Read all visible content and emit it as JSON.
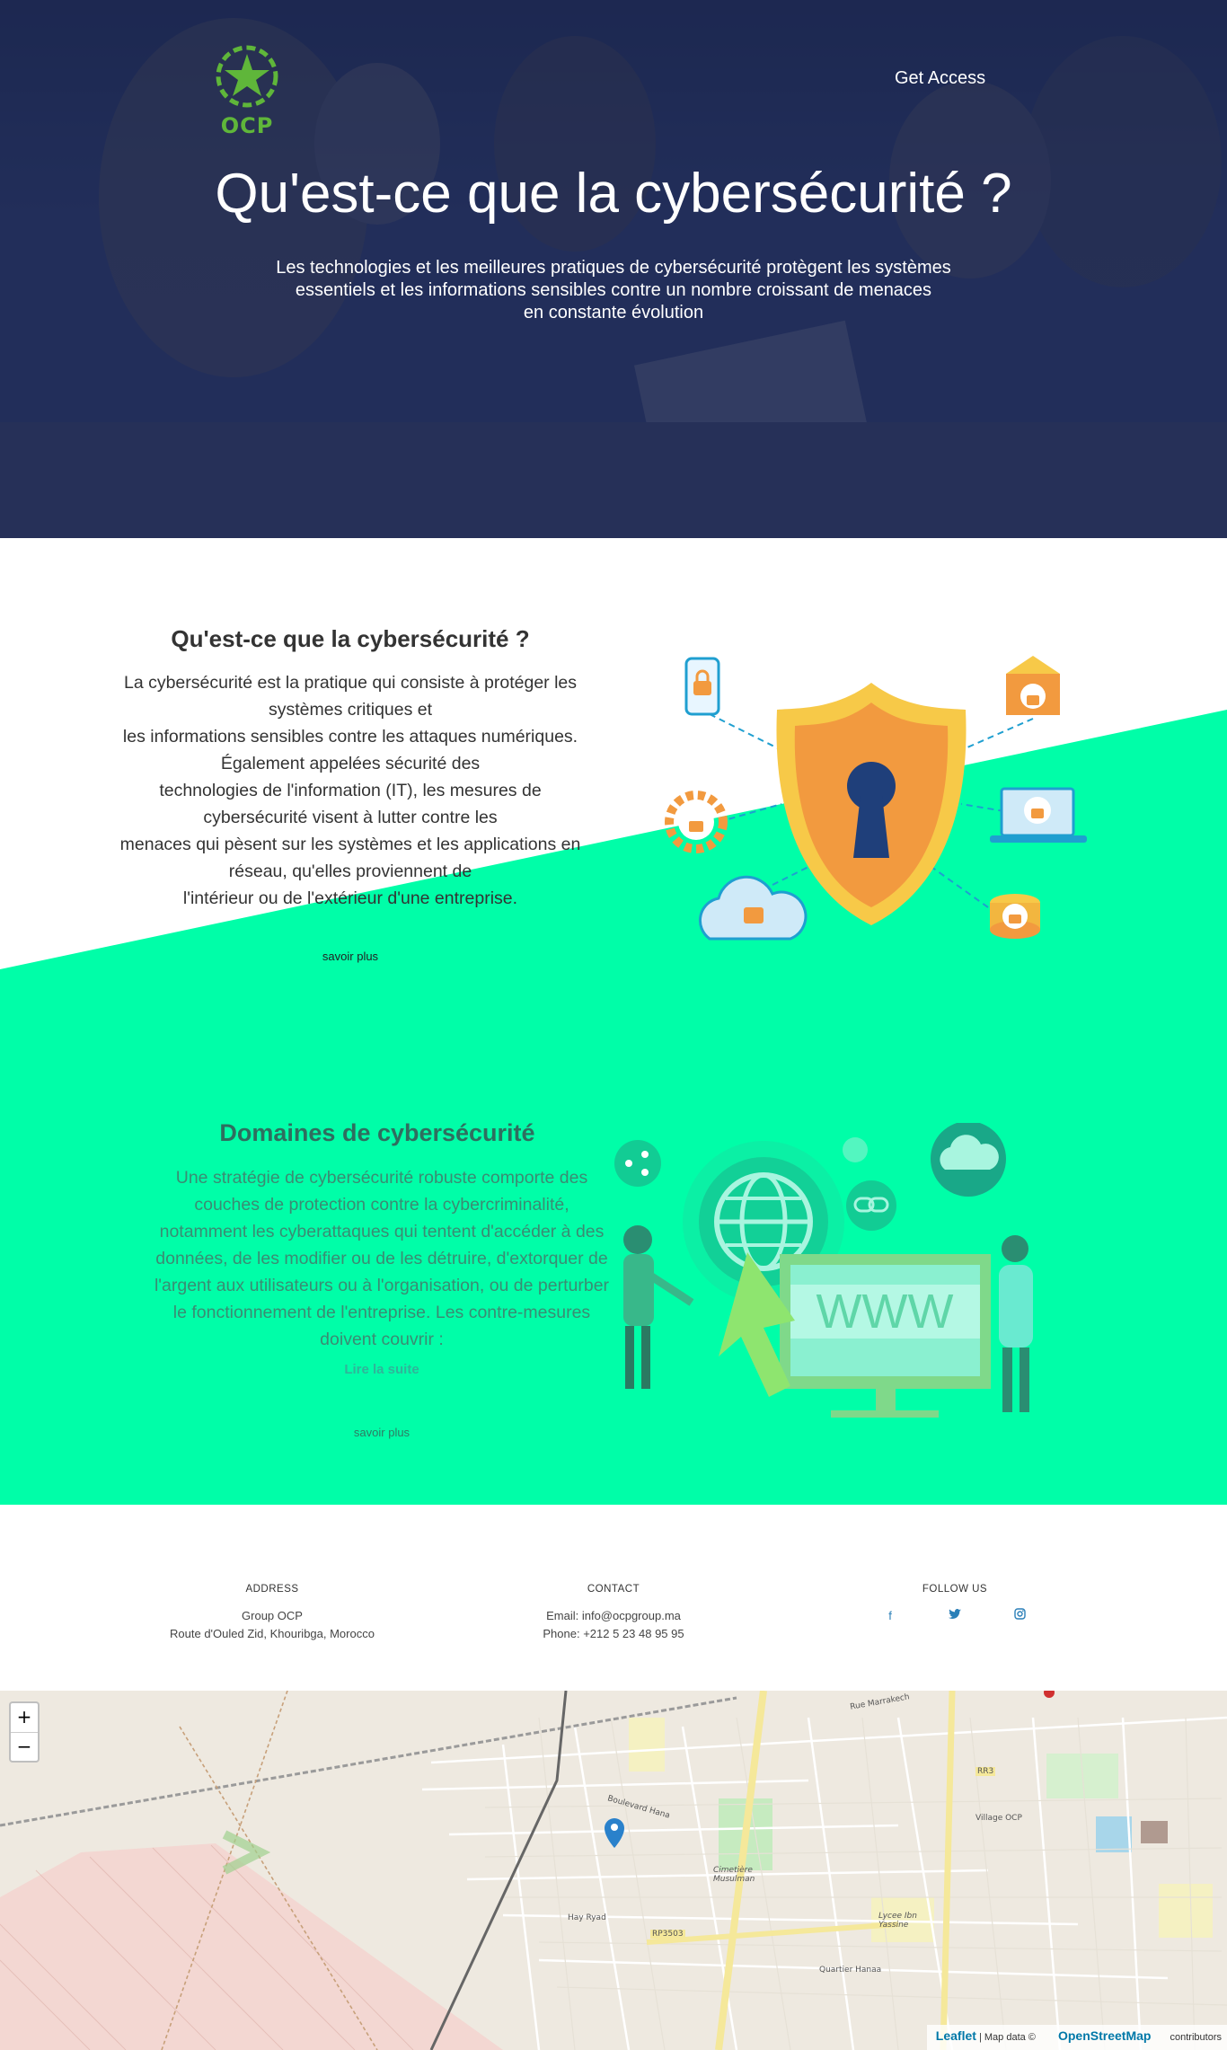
{
  "hero": {
    "logo_text": "OCP",
    "get_access": "Get Access",
    "title": "Qu'est-ce que la cybersécurité ?",
    "subtitle_lines": [
      "Les technologies et les meilleures pratiques de cybersécurité protègent les systèmes",
      "essentiels et les informations sensibles contre un nombre croissant de menaces",
      "en constante évolution"
    ]
  },
  "section1": {
    "title": "Qu'est-ce que la cybersécurité ?",
    "body_lines": [
      "La cybersécurité est la pratique qui consiste à protéger les",
      "systèmes critiques et",
      "les informations sensibles contre les attaques numériques.",
      "Également appelées sécurité des",
      "technologies de l'information (IT), les mesures de",
      "cybersécurité visent à lutter contre les",
      "menaces qui pèsent sur les systèmes et les applications en",
      "réseau, qu'elles proviennent de",
      "l'intérieur ou de l'extérieur d'une entreprise."
    ],
    "more": "savoir plus"
  },
  "section2": {
    "title": "Domaines de cybersécurité",
    "body_lines": [
      "Une stratégie de cybersécurité robuste comporte des",
      "couches de protection contre la cybercriminalité,",
      "notamment les cyberattaques qui tentent d'accéder à des",
      "données, de les modifier ou de les détruire, d'extorquer de",
      "l'argent aux utilisateurs ou à l'organisation, ou de perturber",
      "le fonctionnement de l'entreprise. Les contre-mesures",
      "doivent couvrir :"
    ],
    "read_more": "Lire la suite",
    "more": "savoir plus",
    "www_text": "WWW"
  },
  "footer": {
    "address": {
      "heading": "ADDRESS",
      "line1": "Group OCP",
      "line2": "Route d'Ouled Zid, Khouribga, Morocco"
    },
    "contact": {
      "heading": "CONTACT",
      "email": "Email: info@ocpgroup.ma",
      "phone": "Phone: +212 5 23 48 95 95"
    },
    "follow": {
      "heading": "FOLLOW US",
      "icons": [
        "facebook-icon",
        "twitter-icon",
        "instagram-icon"
      ]
    }
  },
  "map": {
    "zoom_in": "+",
    "zoom_out": "−",
    "leaflet": "Leaflet",
    "map_data": "| Map data ©",
    "osm": "OpenStreetMap",
    "contributors": "contributors",
    "labels": [
      "Boulevard Hana",
      "Hay Ryad",
      "RP3503",
      "Cimetière Musulman",
      "Village OCP",
      "RR3",
      "Lycee Ibn Yassine",
      "Quartier Hanaa",
      "Rue Marrakech"
    ]
  },
  "colors": {
    "hero_bg": "#2a3866",
    "green": "#00fea8",
    "accent_link": "#2fb59a",
    "shield_yellow": "#f7c948",
    "shield_orange": "#f29a3f",
    "keyhole": "#1f3f7a"
  }
}
